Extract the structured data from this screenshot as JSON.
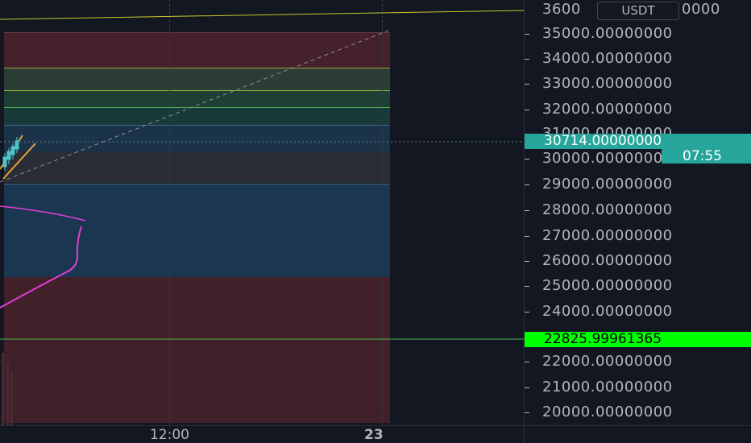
{
  "price_axis": {
    "currency": "USDT",
    "ticks": [
      "3600",
      "0000",
      "35000.00000000",
      "34000.00000000",
      "33000.00000000",
      "32000.00000000",
      "31000.00000000",
      "30000.00000000",
      "29000.00000000",
      "28000.00000000",
      "27000.00000000",
      "26000.00000000",
      "25000.00000000",
      "24000.00000000",
      "22000.00000000",
      "21000.00000000",
      "20000.00000000"
    ],
    "current_price_label": "30714.00000000",
    "countdown_label": "07:55",
    "level_label": "22825.99961365",
    "colors": {
      "current": "#26a69a",
      "level": "#00ff00"
    }
  },
  "time_axis": {
    "labels": [
      "12:00",
      "23"
    ]
  }
}
